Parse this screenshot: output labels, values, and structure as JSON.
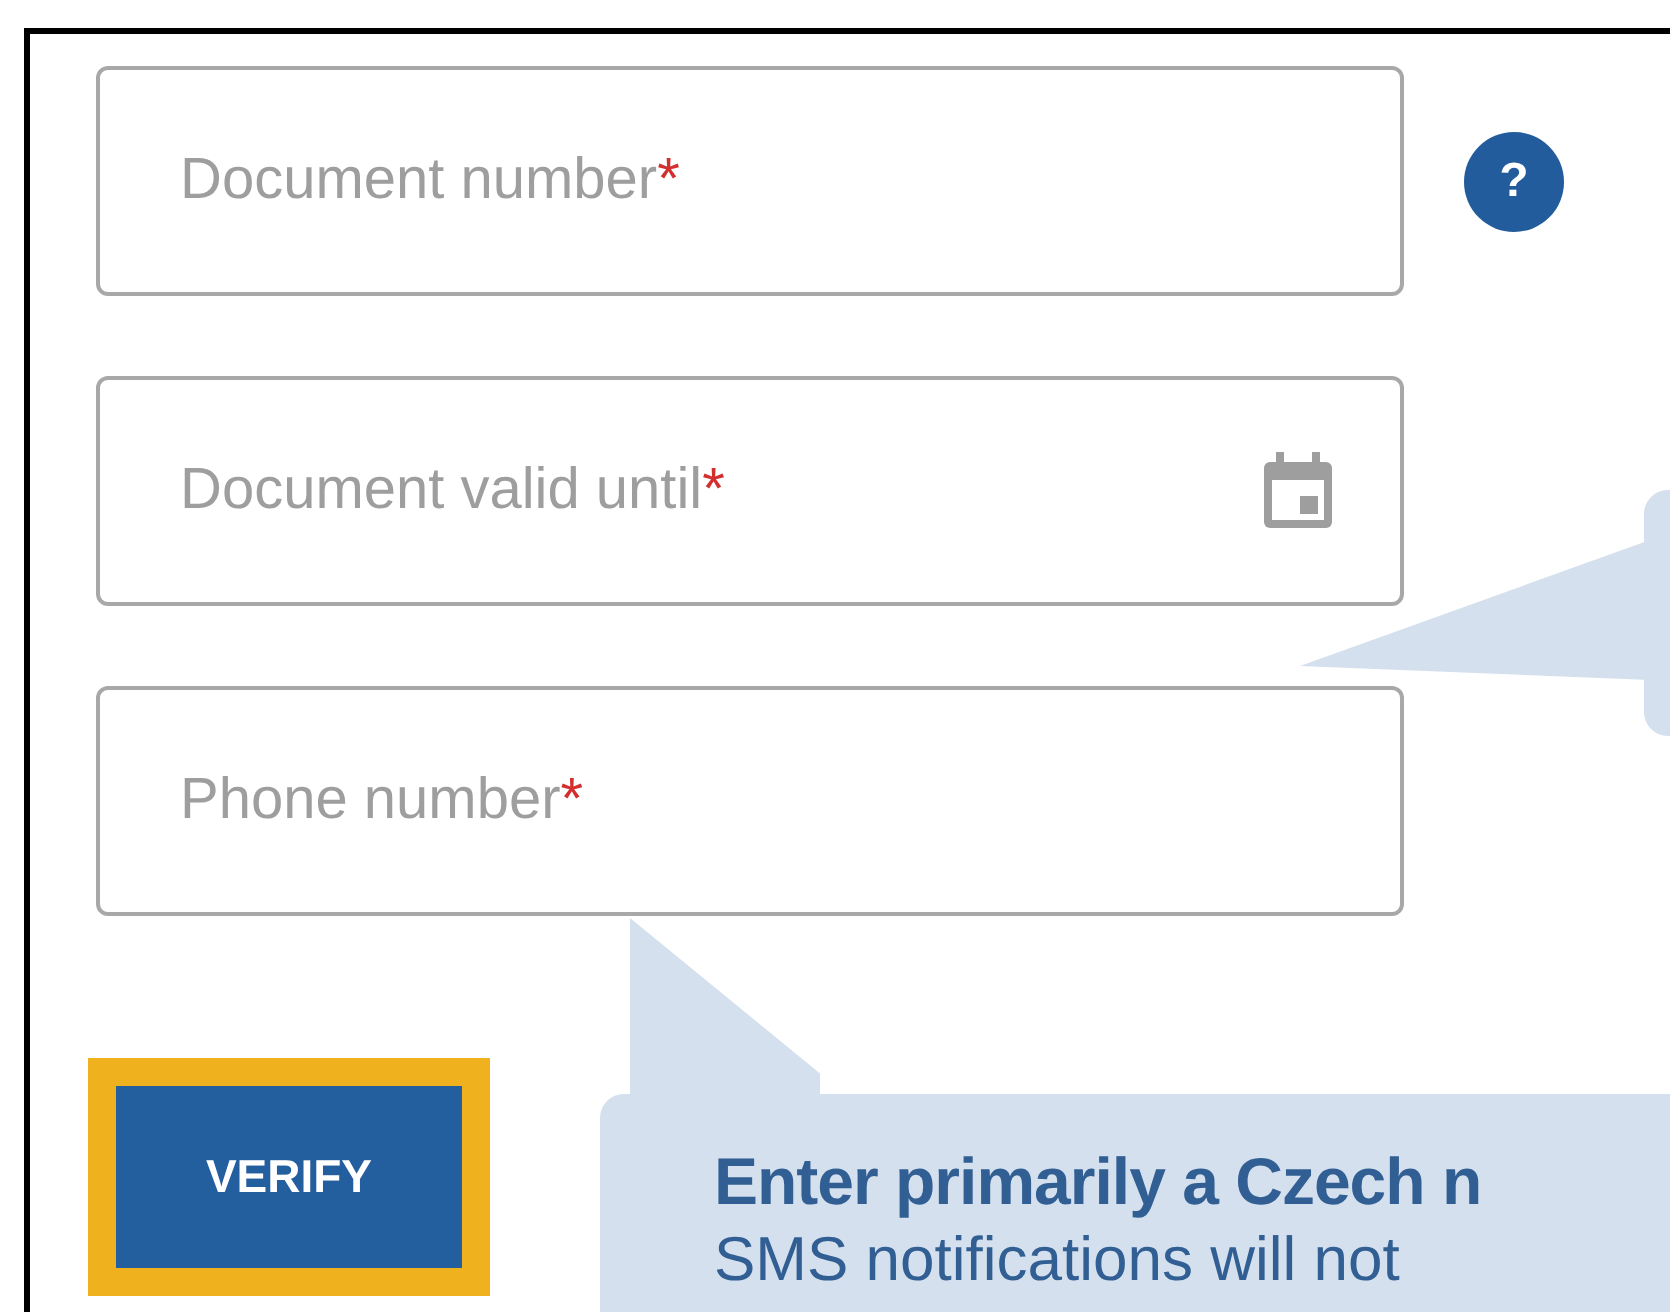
{
  "fields": [
    {
      "kind": "text",
      "placeholder": "Document number",
      "required_mark": "*",
      "help": "?"
    },
    {
      "kind": "date",
      "placeholder": "Document valid until",
      "required_mark": "*"
    },
    {
      "kind": "text",
      "placeholder": "Phone number",
      "required_mark": "*"
    }
  ],
  "verify_button": {
    "label": "VERIFY",
    "highlighted": true
  },
  "hint": {
    "title": "Enter primarily a Czech n",
    "text": "SMS notifications will not"
  }
}
